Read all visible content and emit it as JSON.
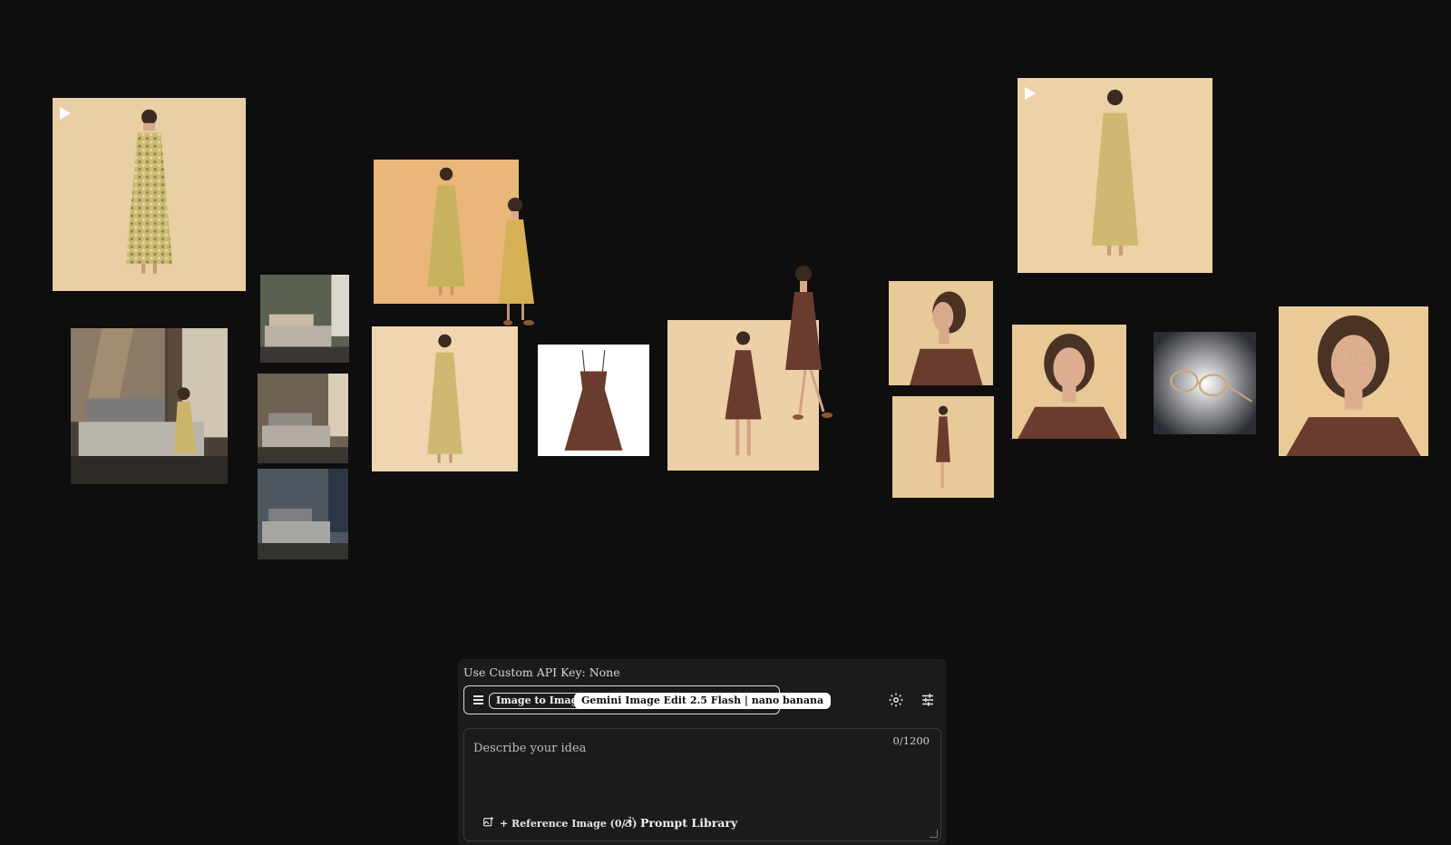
{
  "panel": {
    "api_key_label": "Use Custom API Key: None",
    "mode_label": "Image to Image",
    "model_label": "Gemini Image Edit 2.5 Flash | nano banana",
    "prompt_placeholder": "Describe your idea",
    "char_counter": "0/1200",
    "reference_image_label": "+ Reference Image (0/3)",
    "prompt_library_label": "Prompt Library"
  },
  "canvas_items": [
    {
      "name": "video-floral-dress-full-body",
      "type": "video"
    },
    {
      "name": "image-bedroom-woman-sitting",
      "type": "image"
    },
    {
      "name": "image-bedroom-green-wall",
      "type": "image"
    },
    {
      "name": "image-bedroom-warm",
      "type": "image"
    },
    {
      "name": "image-bedroom-blue-wall",
      "type": "image"
    },
    {
      "name": "image-two-women-floral-dress",
      "type": "image"
    },
    {
      "name": "image-floral-dress-front",
      "type": "image"
    },
    {
      "name": "image-brown-dress-product",
      "type": "image"
    },
    {
      "name": "image-brown-dress-two-women",
      "type": "image"
    },
    {
      "name": "image-portrait-side",
      "type": "image"
    },
    {
      "name": "image-full-body-side",
      "type": "image"
    },
    {
      "name": "video-floral-dress-right",
      "type": "video"
    },
    {
      "name": "image-portrait-front",
      "type": "image"
    },
    {
      "name": "image-glasses-product",
      "type": "image"
    },
    {
      "name": "image-portrait-glasses",
      "type": "image"
    }
  ],
  "colors": {
    "background": "#0e0e0f",
    "panel": "#1b1b1c",
    "beige": "#e9cfa3",
    "floral": "#c9b56a",
    "brown_dress": "#6a3c2e"
  }
}
